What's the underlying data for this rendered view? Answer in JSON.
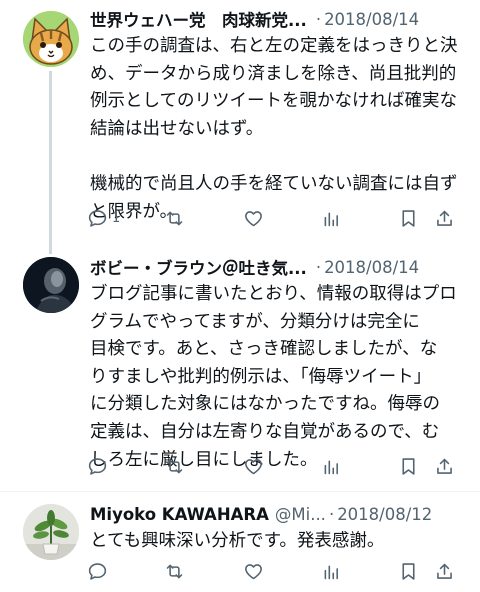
{
  "tweets": [
    {
      "name": "世界ウェハー党　肉球新党...",
      "handle": "",
      "date": "2018/08/14",
      "lines": [
        "この手の調査は、右と左の定義をはっきりと決",
        "め、データから成り済ましを除き、尚且批判的",
        "例示としてのリツイートを覗かなければ確実な",
        "結論は出せないはず。",
        "機械的で尚且人の手を経ていない調査には自ず",
        "と限界が。"
      ],
      "reply_count": "1",
      "avatar": "cat-face-icon"
    },
    {
      "name": "ボビー・ブラウン＠吐き気...",
      "handle": "",
      "date": "2018/08/14",
      "lines": [
        "ブログ記事に書いたとおり、情報の取得はプロ",
        "グラムでやってますが、分類分けは完全に",
        "目検です。あと、さっき確認しましたが、な",
        "りすましや批判的例示は、「侮辱ツイート」",
        "に分類した対象にはなかったですね。侮辱の",
        "定義は、自分は左寄りな自覚があるので、む",
        "しろ左に厳し目にしました。"
      ],
      "reply_count": "",
      "avatar": "dark-portrait-icon"
    },
    {
      "name": "Miyoko KAWAHARA",
      "handle": "@Mi...",
      "date": "2018/08/12",
      "lines": [
        "とても興味深い分析です。発表感謝。"
      ],
      "reply_count": "",
      "avatar": "plant-photo-icon"
    }
  ],
  "separator": "·",
  "icons": [
    "reply-icon",
    "retweet-icon",
    "like-icon",
    "views-icon",
    "bookmark-icon",
    "share-icon"
  ],
  "colors": {
    "text": "#0f1419",
    "secondary": "#536471",
    "thread_line": "#cfd9de",
    "cat_fur": "#e8a94a"
  }
}
